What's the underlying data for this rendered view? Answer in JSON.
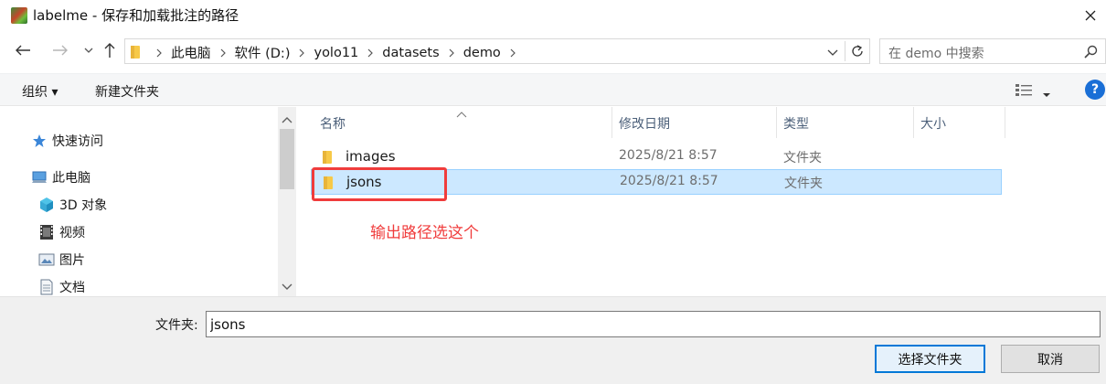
{
  "window": {
    "title": "labelme - 保存和加载批注的路径",
    "app_icon": "labelme-app-icon",
    "close_icon": "close-icon"
  },
  "nav": {
    "back_icon": "back-arrow-icon",
    "forward_icon": "forward-arrow-icon",
    "recent_icon": "chevron-down-icon",
    "up_icon": "up-arrow-icon",
    "breadcrumbs": [
      "此电脑",
      "软件 (D:)",
      "yolo11",
      "datasets",
      "demo"
    ],
    "search_placeholder": "在 demo 中搜索"
  },
  "toolbar": {
    "organize_label": "组织 ▾",
    "new_folder_label": "新建文件夹",
    "help_label": "?"
  },
  "sidebar": {
    "items": [
      {
        "label": "快速访问",
        "icon": "star-icon"
      },
      {
        "label": "此电脑",
        "icon": "computer-icon"
      },
      {
        "label": "3D 对象",
        "icon": "cube-3d-icon"
      },
      {
        "label": "视频",
        "icon": "video-icon"
      },
      {
        "label": "图片",
        "icon": "picture-icon"
      },
      {
        "label": "文档",
        "icon": "document-icon"
      }
    ]
  },
  "filelist": {
    "columns": [
      "名称",
      "修改日期",
      "类型",
      "大小"
    ],
    "rows": [
      {
        "name": "images",
        "date": "2025/8/21 8:57",
        "type": "文件夹",
        "size": "",
        "selected": false
      },
      {
        "name": "jsons",
        "date": "2025/8/21 8:57",
        "type": "文件夹",
        "size": "",
        "selected": true
      }
    ],
    "annotation": "输出路径选这个",
    "annotation_color": "#f03c3c"
  },
  "footer": {
    "folder_label": "文件夹:",
    "folder_value": "jsons",
    "select_button": "选择文件夹",
    "cancel_button": "取消"
  },
  "colors": {
    "selection_bg": "#cce8ff",
    "selection_border": "#99d1ff",
    "accent": "#0078d7"
  }
}
